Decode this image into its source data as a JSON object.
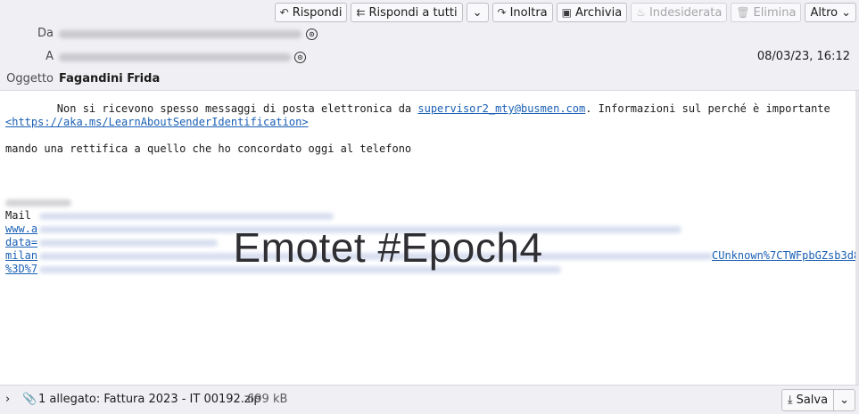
{
  "toolbar": {
    "reply": "Rispondi",
    "reply_all": "Rispondi a tutti",
    "forward": "Inoltra",
    "archive": "Archivia",
    "junk": "Indesiderata",
    "delete": "Elimina",
    "more": "Altro",
    "icons": {
      "reply": "reply-icon",
      "reply_all": "reply-all-icon",
      "forward": "forward-icon",
      "archive": "archive-icon",
      "junk": "fire-icon",
      "delete": "trash-icon",
      "more": "chevron-down-icon"
    }
  },
  "header": {
    "from_label": "Da",
    "to_label": "A",
    "subject_label": "Oggetto",
    "subject_value": "Fagandini Frida",
    "date": "08/03/23, 16:12"
  },
  "body": {
    "warning_prefix": "        Non si ricevono spesso messaggi di posta elettronica da ",
    "warning_link": "supervisor2_mty@busmen.com",
    "warning_suffix": ". Informazioni sul perché è importante",
    "learn_link": "<https://aka.ms/LearnAboutSenderIdentification>",
    "message": "mando una rettifica a quello che ho concordato oggi al telefono",
    "mail_label": "Mail",
    "link_www": "www.a",
    "link_data": "data=",
    "link_milan": "milan",
    "link_pct": "%3D%7",
    "unknown_link": "CUnknown%7CTWFpbGZsb3d8"
  },
  "overlay": "Emotet #Epoch4",
  "attachment": {
    "summary": "1 allegato: Fattura 2023 - IT 00192.zip",
    "size": "699 kB",
    "save": "Salva"
  }
}
